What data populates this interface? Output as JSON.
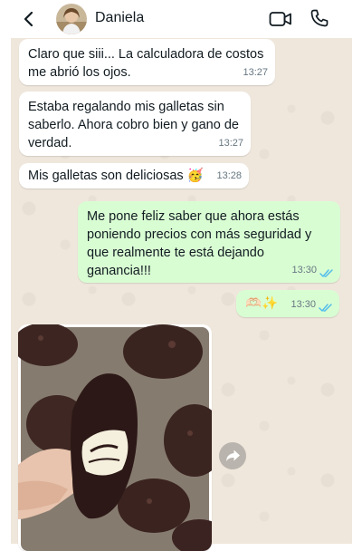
{
  "header": {
    "contact_name": "Daniela"
  },
  "messages": [
    {
      "direction": "in",
      "text": "Claro que siii... La calculadora de costos\nme abrió los ojos.",
      "time": "13:27"
    },
    {
      "direction": "in",
      "text": "Estaba regalando mis galletas sin\nsaberlo. Ahora cobro bien y gano de\nverdad.",
      "time": "13:27"
    },
    {
      "direction": "in",
      "text": "Mis galletas son deliciosas 🥳",
      "time": "13:28"
    },
    {
      "direction": "out",
      "text": "Me pone feliz saber que ahora estás\nponiendo precios con más seguridad y\nque realmente te está dejando ganancia!!!",
      "time": "13:30",
      "status": "read"
    },
    {
      "direction": "out",
      "text": "🫶🏻✨",
      "time": "13:30",
      "status": "read"
    }
  ],
  "photo_message": {
    "content": "chocolate-cookies-photo"
  },
  "colors": {
    "chat_background": "#efe7dc",
    "incoming_bubble": "#ffffff",
    "outgoing_bubble": "#d9fdd3",
    "read_check": "#53bdeb",
    "timestamp": "#667781"
  }
}
